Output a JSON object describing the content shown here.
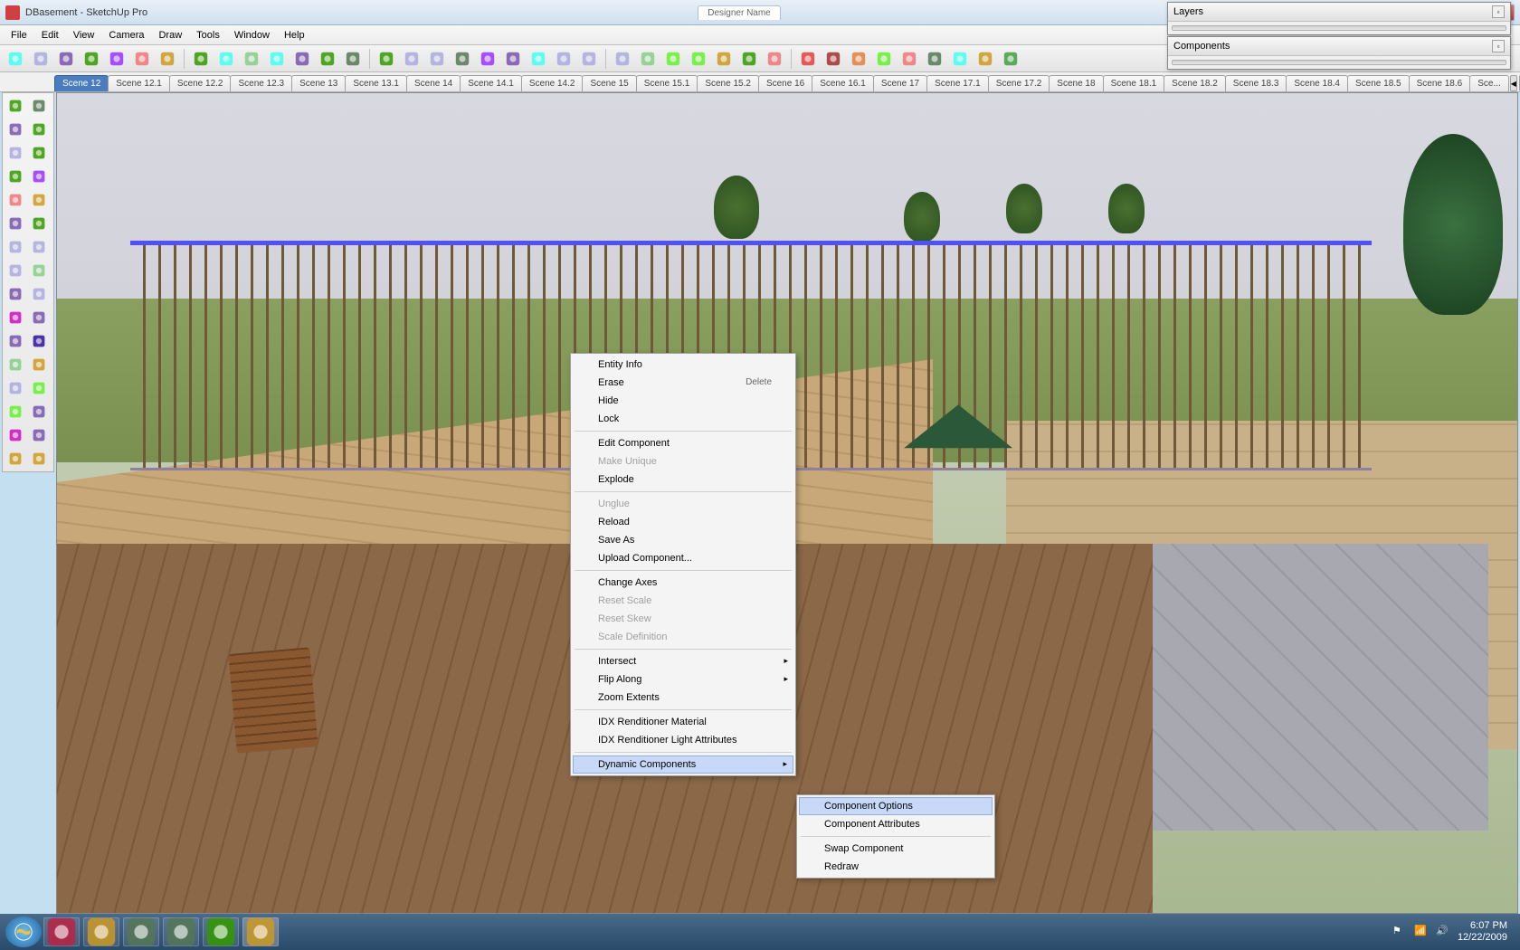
{
  "window": {
    "app_icon": "sketchup-icon",
    "title": "DBasement - SketchUp Pro",
    "bg_tab": "Designer Name"
  },
  "menu": [
    "File",
    "Edit",
    "View",
    "Camera",
    "Draw",
    "Tools",
    "Window",
    "Help"
  ],
  "toolbar_icons": [
    "select-arrow",
    "rectangle",
    "line",
    "circle",
    "arc",
    "polygon",
    "freehand",
    "eraser",
    "tape-measure",
    "protractor",
    "paint-bucket",
    "move",
    "rotate",
    "scale",
    "offset",
    "push-pull",
    "follow-me",
    "orbit",
    "pan",
    "zoom",
    "zoom-extents",
    "prev-view",
    "next-view",
    "component",
    "get-models",
    "share-model",
    "3dwarehouse",
    "outliner",
    "layers",
    "shadows",
    "render-red",
    "render-darkred",
    "render-orange",
    "photo-match",
    "section",
    "style",
    "presentation",
    "settings",
    "help"
  ],
  "scenes": {
    "active": "Scene 12",
    "list": [
      "Scene 12",
      "Scene 12.1",
      "Scene 12.2",
      "Scene 12.3",
      "Scene 13",
      "Scene 13.1",
      "Scene 14",
      "Scene 14.1",
      "Scene 14.2",
      "Scene 15",
      "Scene 15.1",
      "Scene 15.2",
      "Scene 16",
      "Scene 16.1",
      "Scene 17",
      "Scene 17.1",
      "Scene 17.2",
      "Scene 18",
      "Scene 18.1",
      "Scene 18.2",
      "Scene 18.3",
      "Scene 18.4",
      "Scene 18.5",
      "Scene 18.6",
      "Sce..."
    ]
  },
  "left_tools": [
    "select",
    "paint",
    "line",
    "eraser",
    "rectangle",
    "pencil",
    "circle",
    "arc",
    "polygon",
    "freehand",
    "move",
    "rotate",
    "push-pull",
    "follow-me",
    "scale-red",
    "offset-red",
    "tape",
    "dimension",
    "protractor-tool",
    "text",
    "axes",
    "section-plane",
    "orbit-tool",
    "pan-tool",
    "zoom-tool",
    "zoom-window",
    "look-around",
    "walk",
    "position-camera",
    "prev",
    "sandbox1",
    "sandbox2"
  ],
  "context_menu": {
    "items": [
      {
        "label": "Entity Info"
      },
      {
        "label": "Erase",
        "shortcut": "Delete"
      },
      {
        "label": "Hide"
      },
      {
        "label": "Lock"
      },
      {
        "sep": true
      },
      {
        "label": "Edit Component"
      },
      {
        "label": "Make Unique",
        "disabled": true
      },
      {
        "label": "Explode"
      },
      {
        "sep": true
      },
      {
        "label": "Unglue",
        "disabled": true
      },
      {
        "label": "Reload"
      },
      {
        "label": "Save As"
      },
      {
        "label": "Upload Component..."
      },
      {
        "sep": true
      },
      {
        "label": "Change Axes"
      },
      {
        "label": "Reset Scale",
        "disabled": true
      },
      {
        "label": "Reset Skew",
        "disabled": true
      },
      {
        "label": "Scale Definition",
        "disabled": true
      },
      {
        "sep": true
      },
      {
        "label": "Intersect",
        "submenu": true
      },
      {
        "label": "Flip Along",
        "submenu": true
      },
      {
        "label": "Zoom Extents"
      },
      {
        "sep": true
      },
      {
        "label": "IDX Renditioner Material"
      },
      {
        "label": "IDX Renditioner Light Attributes"
      },
      {
        "sep": true
      },
      {
        "label": "Dynamic Components",
        "submenu": true,
        "highlighted": true
      }
    ],
    "submenu": {
      "items": [
        {
          "label": "Component Options",
          "highlighted": true
        },
        {
          "label": "Component Attributes"
        },
        {
          "sep": true
        },
        {
          "label": "Swap Component"
        },
        {
          "label": "Redraw"
        }
      ]
    }
  },
  "panels": {
    "layers": {
      "title": "Layers"
    },
    "components": {
      "title": "Components"
    }
  },
  "taskbar": {
    "apps": [
      "ie",
      "explorer",
      "media",
      "paint",
      "chrome",
      "sketchup"
    ],
    "time": "6:07 PM",
    "date": "12/22/2009"
  }
}
